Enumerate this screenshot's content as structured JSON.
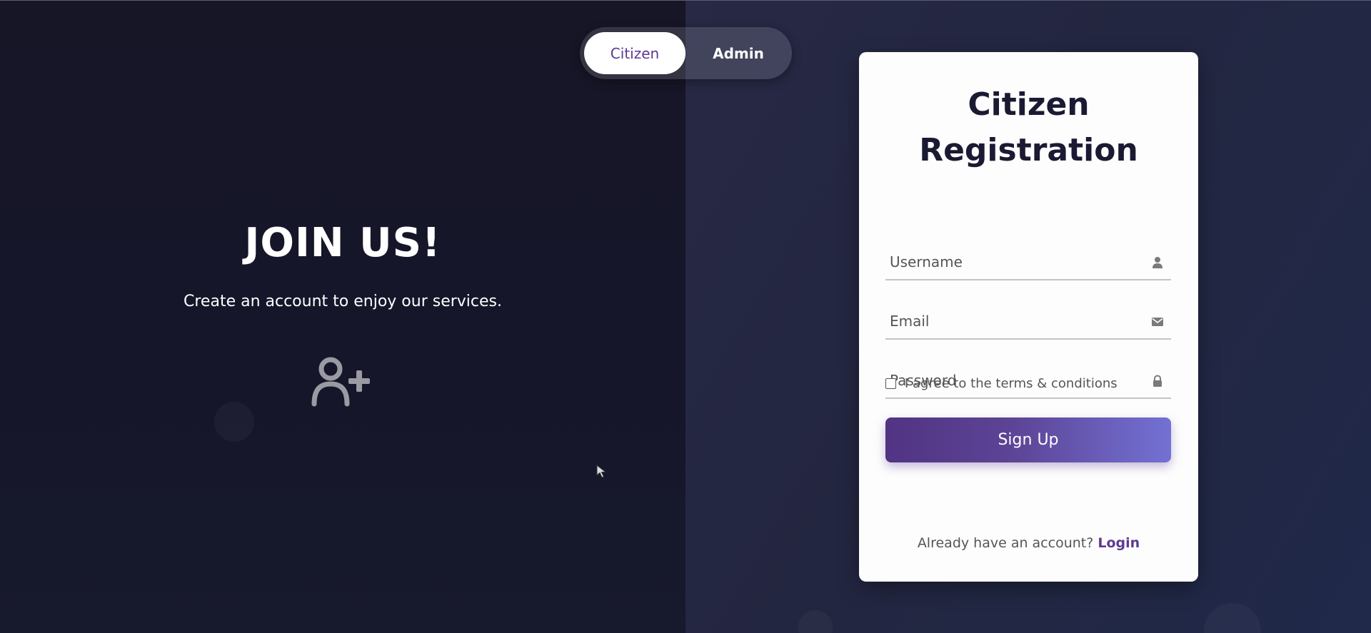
{
  "toggle": {
    "citizen_label": "Citizen",
    "admin_label": "Admin",
    "active": "Citizen"
  },
  "hero": {
    "title": "JOIN US!",
    "subtitle": "Create an account to enjoy our services.",
    "icon": "user-plus-icon"
  },
  "form": {
    "title_line1": "Citizen",
    "title_line2": "Registration",
    "username_placeholder": "Username",
    "email_placeholder": "Email",
    "password_placeholder": "Password",
    "username_icon": "user-icon",
    "email_icon": "envelope-icon",
    "password_icon": "lock-icon",
    "terms_label": "I agree to the terms & conditions",
    "terms_checked": false,
    "submit_label": "Sign Up",
    "login_prompt": "Already have an account?",
    "login_link": "Login"
  },
  "colors": {
    "accent": "#5b3a92",
    "button_gradient_start": "#513483",
    "button_gradient_end": "#7371d4",
    "left_background": "#161627",
    "right_background": "#252843",
    "card_background": "#fdfdfd",
    "title_text": "#1a1a33"
  }
}
